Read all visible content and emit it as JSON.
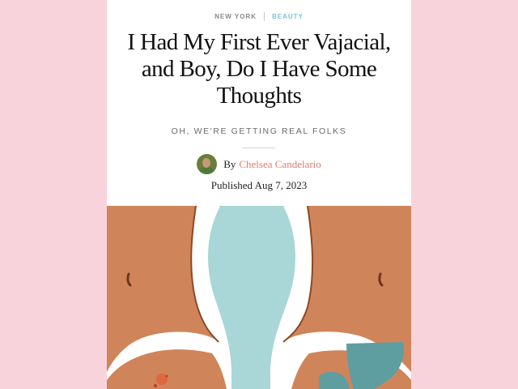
{
  "article": {
    "location": "NEW YORK",
    "category": "BEAUTY",
    "title": "I Had My First Ever Vajacial, and Boy, Do I Have Some Thoughts",
    "dek": "OH, WE'RE GETTING REAL FOLKS",
    "byline_prefix": "By",
    "author": "Chelsea Candelario",
    "published": "Published Aug 7, 2023"
  },
  "colors": {
    "background": "#f9d3dc",
    "category_link": "#7fc2d8",
    "author_link": "#e07b6c",
    "illustration_skin": "#d0845a",
    "illustration_teal": "#a9d6d6"
  }
}
